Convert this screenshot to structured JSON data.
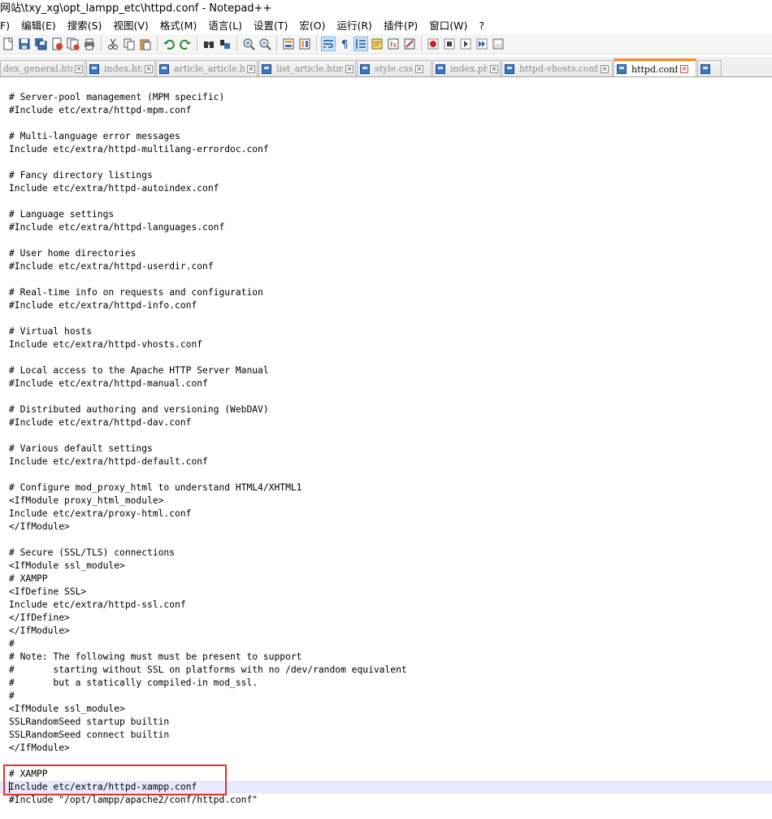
{
  "window": {
    "title": "网站\\txy_xg\\opt_lampp_etc\\httpd.conf - Notepad++"
  },
  "menubar": {
    "items": [
      "F)",
      "编辑(E)",
      "搜索(S)",
      "视图(V)",
      "格式(M)",
      "语言(L)",
      "设置(T)",
      "宏(O)",
      "运行(R)",
      "插件(P)",
      "窗口(W)",
      "?"
    ]
  },
  "toolbar": {
    "icons": [
      "new-file-icon",
      "save-icon",
      "save-all-icon",
      "close-file-icon",
      "close-all-icon",
      "print-icon",
      "cut-icon",
      "copy-icon",
      "paste-icon",
      "undo-icon",
      "redo-icon",
      "find-icon",
      "replace-icon",
      "zoom-in-icon",
      "zoom-out-icon",
      "sync-vertical-icon",
      "sync-horizontal-icon",
      "word-wrap-icon",
      "show-all-characters-icon",
      "indent-guide-icon",
      "document-map-icon",
      "function-list-icon",
      "folder-as-workspace-icon",
      "record-macro-icon",
      "stop-recording-icon",
      "play-macro-icon",
      "run-macro-multiple-icon",
      "save-macro-icon"
    ]
  },
  "tabs": [
    {
      "label": "dex_general.htm",
      "active": false
    },
    {
      "label": "index.htm",
      "active": false
    },
    {
      "label": "article_article.htm",
      "active": false
    },
    {
      "label": "list_article.htm",
      "active": false
    },
    {
      "label": "style.css",
      "active": false
    },
    {
      "label": "index.php",
      "active": false
    },
    {
      "label": "httpd-vhosts.conf",
      "active": false
    },
    {
      "label": "httpd.conf",
      "active": true
    }
  ],
  "editor": {
    "lines": [
      "# Server-pool management (MPM specific)",
      "#Include etc/extra/httpd-mpm.conf",
      "",
      "# Multi-language error messages",
      "Include etc/extra/httpd-multilang-errordoc.conf",
      "",
      "# Fancy directory listings",
      "Include etc/extra/httpd-autoindex.conf",
      "",
      "# Language settings",
      "#Include etc/extra/httpd-languages.conf",
      "",
      "# User home directories",
      "#Include etc/extra/httpd-userdir.conf",
      "",
      "# Real-time info on requests and configuration",
      "#Include etc/extra/httpd-info.conf",
      "",
      "# Virtual hosts",
      "Include etc/extra/httpd-vhosts.conf",
      "",
      "# Local access to the Apache HTTP Server Manual",
      "#Include etc/extra/httpd-manual.conf",
      "",
      "# Distributed authoring and versioning (WebDAV)",
      "#Include etc/extra/httpd-dav.conf",
      "",
      "# Various default settings",
      "Include etc/extra/httpd-default.conf",
      "",
      "# Configure mod_proxy_html to understand HTML4/XHTML1",
      "<IfModule proxy_html_module>",
      "Include etc/extra/proxy-html.conf",
      "</IfModule>",
      "",
      "# Secure (SSL/TLS) connections",
      "<IfModule ssl_module>",
      "# XAMPP",
      "<IfDefine SSL>",
      "Include etc/extra/httpd-ssl.conf",
      "</IfDefine>",
      "</IfModule>",
      "#",
      "# Note: The following must must be present to support",
      "#       starting without SSL on platforms with no /dev/random equivalent",
      "#       but a statically compiled-in mod_ssl.",
      "#",
      "<IfModule ssl_module>",
      "SSLRandomSeed startup builtin",
      "SSLRandomSeed connect builtin",
      "</IfModule>",
      "",
      "# XAMPP",
      "Include etc/extra/httpd-xampp.conf",
      "#Include \"/opt/lampp/apache2/conf/httpd.conf\""
    ]
  }
}
